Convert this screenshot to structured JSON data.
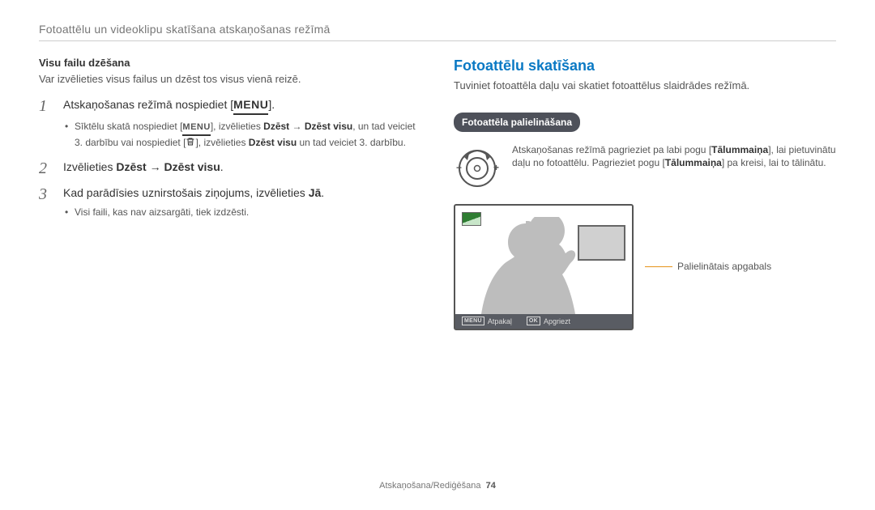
{
  "header": {
    "breadcrumb": "Fotoattēlu un videoklipu skatīšana atskaņošanas režīmā"
  },
  "left": {
    "heading": "Visu failu dzēšana",
    "intro": "Var izvēlieties visus failus un dzēst tos visus vienā reizē.",
    "step1": {
      "main_pre": "Atskaņošanas režīmā nospiediet [",
      "main_post": "]."
    },
    "step1_b1_pre": "Sīktēlu skatā nospiediet [",
    "step1_b1_mid": "], izvēlieties ",
    "step1_b1_bold1": "Dzēst",
    "step1_b1_arrow": " → ",
    "step1_b1_bold2": "Dzēst visu",
    "step1_b1_post": ", un tad veiciet 3. darbību vai nospiediet [",
    "step1_b1_after_trash": "], izvēlieties ",
    "step1_b1_bold3": "Dzēst visu",
    "step1_b1_tail": " un tad veiciet 3. darbību.",
    "step2": {
      "main_pre": "Izvēlieties ",
      "b1": "Dzēst",
      "arrow": " → ",
      "b2": "Dzēst visu",
      "post": "."
    },
    "step3": {
      "main_pre": "Kad parādīsies uznirstošais ziņojums, izvēlieties ",
      "b": "Jā",
      "post": ".",
      "b1": "Visi faili, kas nav aizsargāti, tiek izdzēsti."
    }
  },
  "right": {
    "title": "Fotoattēlu skatīšana",
    "intro": "Tuviniet fotoattēla daļu vai skatiet fotoattēlus slaidrādes režīmā.",
    "pill": "Fotoattēla palielināšana",
    "dial_text_pre": "Atskaņošanas režīmā pagrieziet pa labi pogu [",
    "dial_text_b1": "Tālummaiņa",
    "dial_text_mid": "], lai pietuvinātu daļu no fotoattēlu. Pagrieziet pogu [",
    "dial_text_b2": "Tālummaiņa",
    "dial_text_post": "] pa kreisi, lai to tālinātu.",
    "callout": "Palielinātais apgabals",
    "lcd": {
      "back": "Atpakaļ",
      "crop": "Apgriezt",
      "menu": "MENU",
      "ok": "OK"
    }
  },
  "menu_glyph": "MENU",
  "footer": {
    "section": "Atskaņošana/Rediģēšana",
    "page": "74"
  }
}
